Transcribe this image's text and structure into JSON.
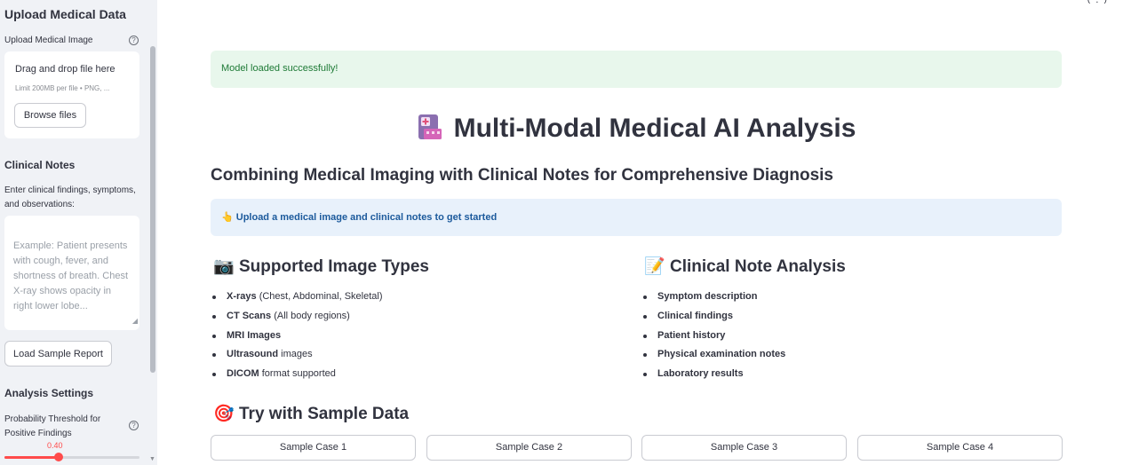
{
  "sidebar": {
    "upload_heading": "Upload Medical Data",
    "upload_label": "Upload Medical Image",
    "dropzone_title": "Drag and drop file here",
    "dropzone_limit": "Limit 200MB per file • PNG, ...",
    "browse_label": "Browse files",
    "notes_heading": "Clinical Notes",
    "notes_label": "Enter clinical findings, symptoms, and observations:",
    "notes_placeholder": "Example: Patient presents with cough, fever, and shortness of breath. Chest X-ray shows opacity in right lower lobe...",
    "load_sample_label": "Load Sample Report",
    "settings_heading": "Analysis Settings",
    "threshold_label": "Probability Threshold for Positive Findings",
    "threshold_value": "0.40",
    "threshold_fraction": 0.4,
    "help_icon": "?"
  },
  "main": {
    "success_message": "Model loaded successfully!",
    "title": "Multi-Modal Medical AI Analysis",
    "subtitle": "Combining Medical Imaging with Clinical Notes for Comprehensive Diagnosis",
    "info_message": "👆 Upload a medical image and clinical notes to get started",
    "image_types": {
      "emoji": "📷",
      "heading": "Supported Image Types",
      "items": [
        {
          "bold": "X-rays",
          "rest": " (Chest, Abdominal, Skeletal)"
        },
        {
          "bold": "CT Scans",
          "rest": " (All body regions)"
        },
        {
          "bold": "MRI Images",
          "rest": ""
        },
        {
          "bold": "Ultrasound",
          "rest": " images"
        },
        {
          "bold": "DICOM",
          "rest": " format supported"
        }
      ]
    },
    "note_analysis": {
      "emoji": "📝",
      "heading": "Clinical Note Analysis",
      "items": [
        {
          "bold": "Symptom description",
          "rest": ""
        },
        {
          "bold": "Clinical findings",
          "rest": ""
        },
        {
          "bold": "Patient history",
          "rest": ""
        },
        {
          "bold": "Physical examination notes",
          "rest": ""
        },
        {
          "bold": "Laboratory results",
          "rest": ""
        }
      ]
    },
    "sample": {
      "emoji": "🎯",
      "heading": "Try with Sample Data",
      "buttons": [
        "Sample Case 1",
        "Sample Case 2",
        "Sample Case 3",
        "Sample Case 4"
      ]
    }
  },
  "colors": {
    "accent": "#ff4b4b",
    "success_bg": "#e8f7ec",
    "info_bg": "#e8f1fb",
    "sidebar_bg": "#f0f2f6"
  },
  "icons": {
    "title_icon": "hospital-icon",
    "menu_icon": "more-options-icon"
  }
}
